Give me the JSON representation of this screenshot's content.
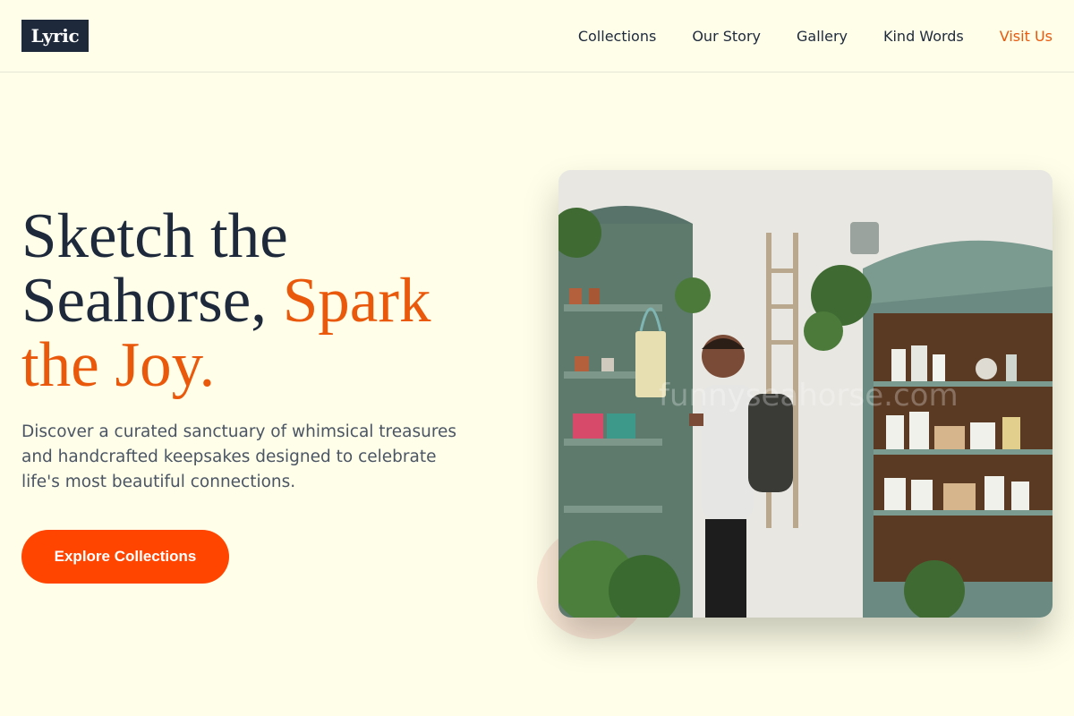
{
  "header": {
    "logo_text": "Lyric",
    "nav": [
      {
        "label": "Collections"
      },
      {
        "label": "Our Story"
      },
      {
        "label": "Gallery"
      },
      {
        "label": "Kind Words"
      },
      {
        "label": "Visit Us"
      }
    ]
  },
  "hero": {
    "headline_part1": "Sketch the Seahorse,",
    "headline_accent": "Spark the Joy.",
    "subtext": "Discover a curated sanctuary of whimsical treasures and handcrafted keepsakes designed to celebrate life's most beautiful connections.",
    "cta_label": "Explore Collections",
    "image_watermark": "funnyseahorse.com"
  },
  "colors": {
    "background": "#fefee9",
    "text_dark": "#1e293b",
    "accent": "#ea580c",
    "button": "#ff4500"
  }
}
